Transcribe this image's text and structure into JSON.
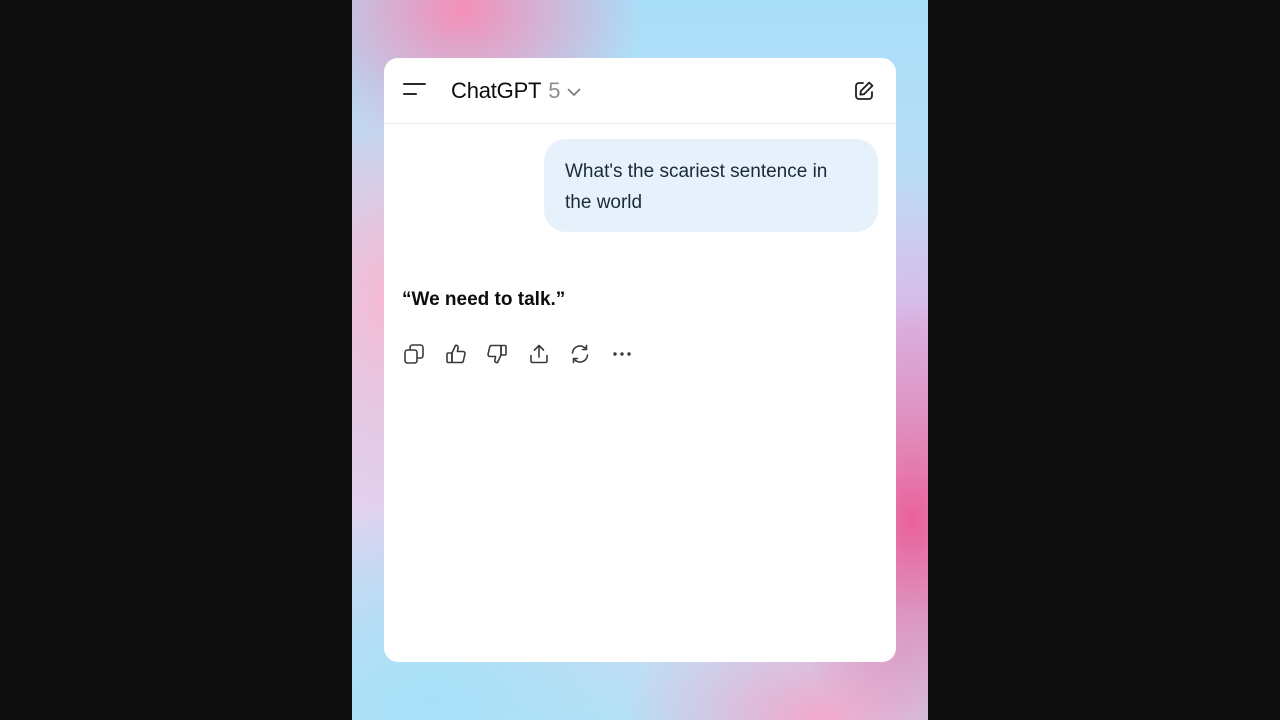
{
  "header": {
    "menu_icon": "menu-icon",
    "model_name": "ChatGPT",
    "model_version": "5",
    "dropdown_icon": "chevron-down-icon",
    "new_chat_icon": "edit-icon"
  },
  "conversation": {
    "user_message": "What's the scariest sentence in the world",
    "assistant_reply": "“We need to talk.”"
  },
  "message_actions": [
    {
      "name": "copy",
      "icon": "copy-icon"
    },
    {
      "name": "good-response",
      "icon": "thumbs-up-icon"
    },
    {
      "name": "bad-response",
      "icon": "thumbs-down-icon"
    },
    {
      "name": "share",
      "icon": "share-icon"
    },
    {
      "name": "regenerate",
      "icon": "refresh-icon"
    },
    {
      "name": "more",
      "icon": "more-icon"
    }
  ],
  "colors": {
    "user_bubble": "#e7f1fb",
    "text": "#0d0d0d",
    "muted": "#8e8e8e"
  }
}
